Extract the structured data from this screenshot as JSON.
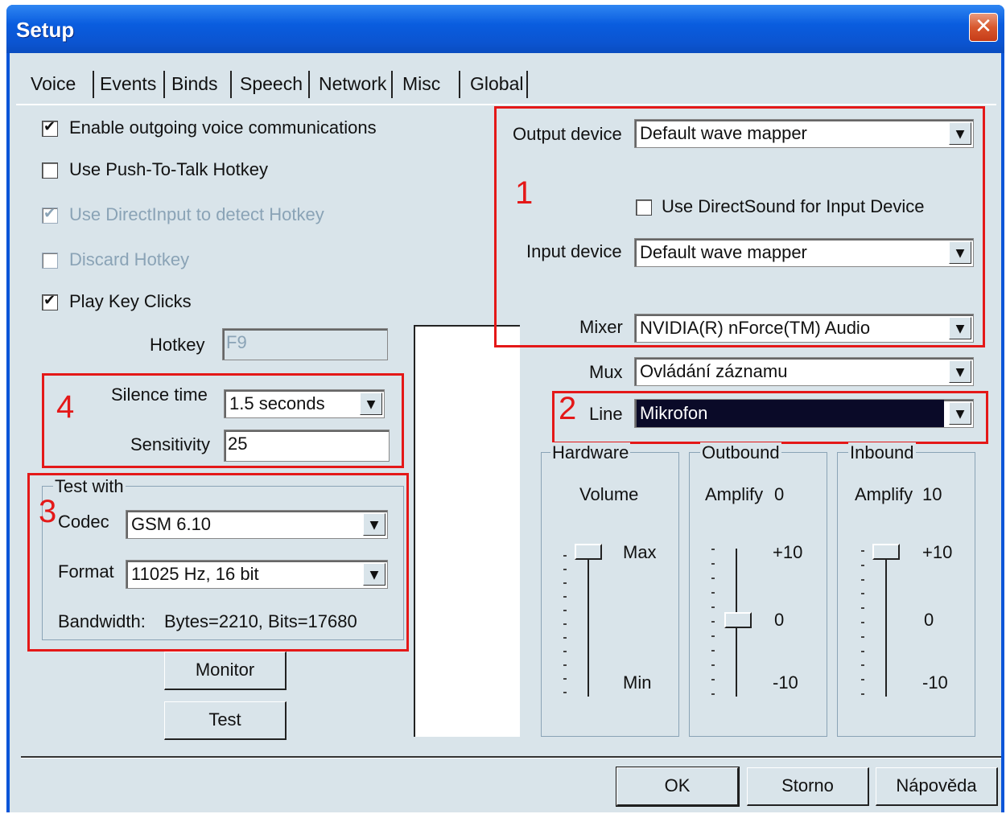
{
  "window": {
    "title": "Setup",
    "close_glyph": "✕"
  },
  "tabs": [
    "Voice",
    "Events",
    "Binds",
    "Speech",
    "Network",
    "Misc",
    "Global"
  ],
  "voice": {
    "enable_outgoing": {
      "label": "Enable outgoing voice communications",
      "checked": true
    },
    "push_to_talk": {
      "label": "Use Push-To-Talk Hotkey",
      "checked": false
    },
    "direct_input": {
      "label": "Use DirectInput to detect Hotkey",
      "checked": true,
      "disabled": true
    },
    "discard_hotkey": {
      "label": "Discard Hotkey",
      "checked": false,
      "disabled": true
    },
    "play_key_clicks": {
      "label": "Play Key Clicks",
      "checked": true
    },
    "hotkey_label": "Hotkey",
    "hotkey_value": "F9",
    "silence_label": "Silence time",
    "silence_value": "1.5 seconds",
    "sensitivity_label": "Sensitivity",
    "sensitivity_value": "25"
  },
  "test_with": {
    "group_label": "Test with",
    "codec_label": "Codec",
    "codec_value": "GSM 6.10",
    "format_label": "Format",
    "format_value": "11025 Hz, 16 bit",
    "bandwidth_label": "Bandwidth:",
    "bandwidth_value": "Bytes=2210, Bits=17680"
  },
  "buttons": {
    "monitor": "Monitor",
    "test": "Test",
    "ok": "OK",
    "cancel": "Storno",
    "help": "Nápověda"
  },
  "devices": {
    "output_label": "Output device",
    "output_value": "Default wave mapper",
    "directsound": {
      "label": "Use DirectSound for Input Device",
      "checked": false
    },
    "input_label": "Input device",
    "input_value": "Default wave mapper",
    "mixer_label": "Mixer",
    "mixer_value": "NVIDIA(R) nForce(TM) Audio",
    "mux_label": "Mux",
    "mux_value": "Ovládání záznamu",
    "line_label": "Line",
    "line_value": "Mikrofon"
  },
  "annotations": [
    "1",
    "2",
    "3",
    "4"
  ],
  "annotation_color": "#e41818",
  "sliders": {
    "hardware": {
      "group": "Hardware",
      "caption": "Volume",
      "max": "Max",
      "min": "Min",
      "level": 1.0
    },
    "outbound": {
      "group": "Outbound",
      "caption": "Amplify",
      "value": "0",
      "top": "+10",
      "mid": "0",
      "bottom": "-10",
      "level": 0.5
    },
    "inbound": {
      "group": "Inbound",
      "caption": "Amplify",
      "value": "10",
      "top": "+10",
      "mid": "0",
      "bottom": "-10",
      "level": 1.0
    }
  },
  "icons": {
    "dropdown": "▼",
    "check": "✔"
  }
}
